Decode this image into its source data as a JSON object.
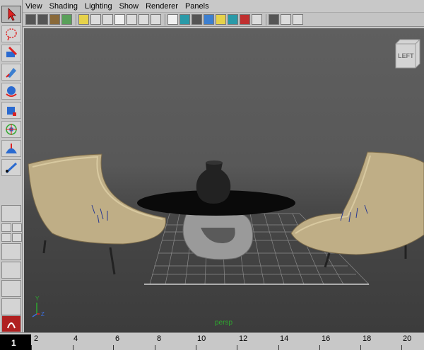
{
  "menu": [
    "View",
    "Shading",
    "Lighting",
    "Show",
    "Renderer",
    "Panels"
  ],
  "viewcube_label": "LEFT",
  "camera_label": "persp",
  "axis": {
    "y": "Y",
    "z": "Z"
  },
  "timeline": {
    "current_frame": "1",
    "ticks": [
      "2",
      "4",
      "6",
      "8",
      "10",
      "12",
      "14",
      "16",
      "18",
      "20"
    ]
  }
}
